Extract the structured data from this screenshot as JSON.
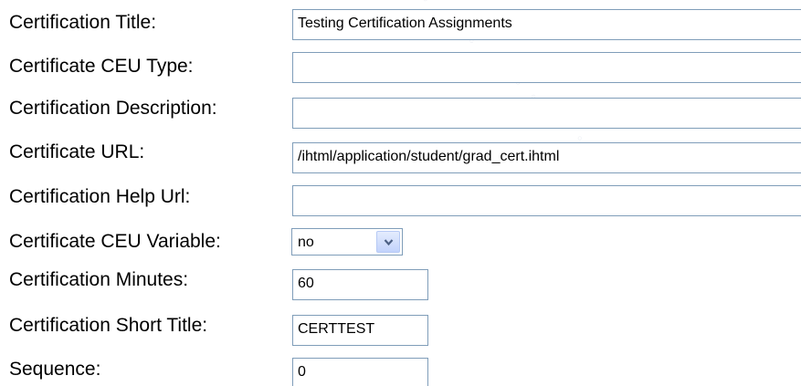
{
  "form": {
    "certification_title": {
      "label": "Certification Title:",
      "value": "Testing Certification Assignments"
    },
    "certificate_ceu_type": {
      "label": "Certificate CEU Type:",
      "value": ""
    },
    "certification_description": {
      "label": "Certification Description:",
      "value": ""
    },
    "certificate_url": {
      "label": "Certificate URL:",
      "value": "/ihtml/application/student/grad_cert.ihtml"
    },
    "certification_help_url": {
      "label": "Certification Help Url:",
      "value": ""
    },
    "certificate_ceu_variable": {
      "label": "Certificate CEU Variable:",
      "selected": "no",
      "icon": "chevron-down-icon"
    },
    "certification_minutes": {
      "label": "Certification Minutes:",
      "value": "60"
    },
    "certification_short_title": {
      "label": "Certification Short Title:",
      "value": "CERTTEST"
    },
    "sequence": {
      "label": "Sequence:",
      "value": "0"
    }
  },
  "colors": {
    "field_border": "#7f9db9",
    "dropdown_button": "#c2d3fc",
    "arrow": "#4d6185"
  }
}
